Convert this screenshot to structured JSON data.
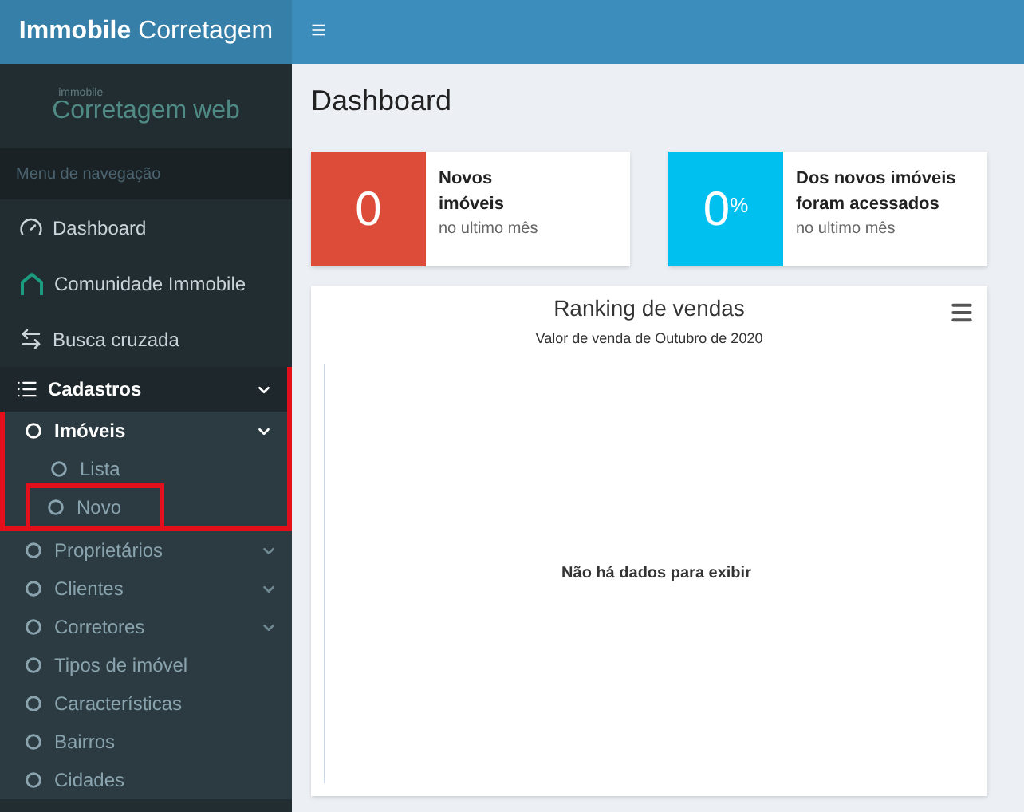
{
  "header": {
    "brand_bold": "Immobile",
    "brand_light": "Corretagem",
    "menu_toggle": "≡"
  },
  "logo": {
    "small": "immobile",
    "main": "Corretagem",
    "accent": "web"
  },
  "sidebar": {
    "heading": "Menu de navegação",
    "items": [
      {
        "kind": "gauge",
        "label": "Dashboard"
      },
      {
        "kind": "home",
        "label": "Comunidade Immobile"
      },
      {
        "kind": "swap",
        "label": "Busca cruzada"
      },
      {
        "kind": "list",
        "label": "Cadastros",
        "expanded": true,
        "highlighted": true,
        "children": [
          {
            "label": "Imóveis",
            "expanded": true,
            "highlighted": false,
            "children": [
              {
                "label": "Lista",
                "highlighted": false
              },
              {
                "label": "Novo",
                "highlighted": true
              }
            ]
          },
          {
            "label": "Proprietários",
            "expanded": false,
            "highlighted": false
          },
          {
            "label": "Clientes",
            "expanded": false,
            "highlighted": false
          },
          {
            "label": "Corretores",
            "expanded": false,
            "highlighted": false
          },
          {
            "label": "Tipos de imóvel",
            "highlighted": false
          },
          {
            "label": "Características",
            "highlighted": false
          },
          {
            "label": "Bairros",
            "highlighted": false
          },
          {
            "label": "Cidades",
            "highlighted": false
          }
        ]
      }
    ]
  },
  "page_title": "Dashboard",
  "info_boxes": [
    {
      "value": "0",
      "title_lines": [
        "Novos",
        "imóveis"
      ],
      "subtitle": "no ultimo mês",
      "color": "#dd4b39"
    },
    {
      "value": "0",
      "unit": "%",
      "title_lines": [
        "Dos novos imóveis",
        "foram acessados"
      ],
      "subtitle": "no ultimo mês",
      "color": "#00c0ef"
    }
  ],
  "chart_card": {
    "title": "Ranking de vendas",
    "subtitle": "Valor de venda de Outubro de 2020",
    "empty_message": "Não há dados para exibir"
  }
}
